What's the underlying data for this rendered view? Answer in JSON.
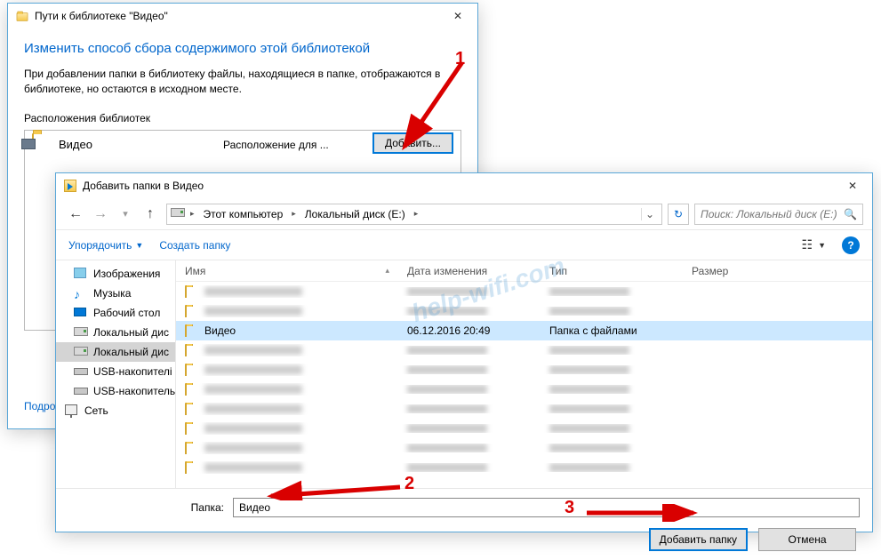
{
  "w1": {
    "title": "Пути к библиотеке \"Видео\"",
    "heading": "Изменить способ сбора содержимого этой библиотекой",
    "desc": "При добавлении папки в библиотеку файлы, находящиеся в папке, отображаются в библиотеке, но остаются в исходном месте.",
    "locationsLabel": "Расположения библиотек",
    "item": {
      "name": "Видео",
      "loc": "Расположение для ..."
    },
    "addBtn": "Добавить...",
    "moreLink": "Подро"
  },
  "w2": {
    "title": "Добавить папки в Видео",
    "breadcrumb": {
      "root": "Этот компьютер",
      "drive": "Локальный диск (E:)"
    },
    "searchPlaceholder": "Поиск: Локальный диск (E:)",
    "toolbar": {
      "organize": "Упорядочить",
      "newFolder": "Создать папку"
    },
    "tree": [
      {
        "label": "Изображения",
        "icon": "pic"
      },
      {
        "label": "Музыка",
        "icon": "mus"
      },
      {
        "label": "Рабочий стол",
        "icon": "desk"
      },
      {
        "label": "Локальный дис",
        "icon": "drive"
      },
      {
        "label": "Локальный дис",
        "icon": "drive",
        "sel": true
      },
      {
        "label": "USB-накопителі",
        "icon": "usb"
      },
      {
        "label": "USB-накопитель",
        "icon": "usb"
      },
      {
        "label": "Сеть",
        "icon": "net",
        "net": true
      }
    ],
    "cols": {
      "name": "Имя",
      "date": "Дата изменения",
      "type": "Тип",
      "size": "Размер"
    },
    "sel": {
      "name": "Видео",
      "date": "06.12.2016 20:49",
      "type": "Папка с файлами"
    },
    "blurRows": 8,
    "folderLabel": "Папка:",
    "folderValue": "Видео",
    "addFolderBtn": "Добавить папку",
    "cancelBtn": "Отмена"
  },
  "annot": {
    "n1": "1",
    "n2": "2",
    "n3": "3"
  },
  "watermark": "help-wifi.com"
}
